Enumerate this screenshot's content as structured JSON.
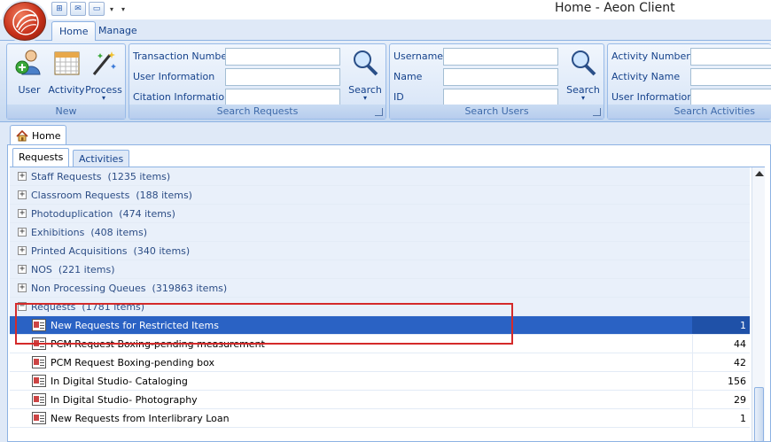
{
  "window": {
    "title": "Home - Aeon Client"
  },
  "ribbon": {
    "tabs": [
      {
        "label": "Home",
        "active": true
      },
      {
        "label": "Manage",
        "active": false
      }
    ],
    "groups": {
      "new": {
        "caption": "New",
        "buttons": [
          {
            "label": "User",
            "icon": "user-add-icon"
          },
          {
            "label": "Activity",
            "icon": "calendar-icon"
          },
          {
            "label": "Process",
            "icon": "wand-icon"
          }
        ]
      },
      "search_requests": {
        "caption": "Search Requests",
        "fields": [
          "Transaction Number",
          "User Information",
          "Citation Information"
        ],
        "values": [
          "",
          "",
          ""
        ],
        "search_label": "Search"
      },
      "search_users": {
        "caption": "Search Users",
        "fields": [
          "Username",
          "Name",
          "ID"
        ],
        "values": [
          "",
          "",
          ""
        ],
        "search_label": "Search"
      },
      "search_activities": {
        "caption": "Search Activities",
        "fields": [
          "Activity Number",
          "Activity Name",
          "User Information"
        ],
        "values": [
          "",
          "",
          ""
        ]
      }
    }
  },
  "document_tab": {
    "label": "Home"
  },
  "subtabs": [
    {
      "label": "Requests",
      "active": true
    },
    {
      "label": "Activities",
      "active": false
    }
  ],
  "groups": [
    {
      "label": "Staff Requests",
      "count": "(1235 items)",
      "expander": "+"
    },
    {
      "label": "Classroom Requests",
      "count": "(188 items)",
      "expander": "+"
    },
    {
      "label": "Photoduplication",
      "count": "(474 items)",
      "expander": "+"
    },
    {
      "label": "Exhibitions",
      "count": "(408 items)",
      "expander": "+"
    },
    {
      "label": "Printed Acquisitions",
      "count": "(340 items)",
      "expander": "+"
    },
    {
      "label": "NOS",
      "count": "(221 items)",
      "expander": "+"
    },
    {
      "label": "Non Processing Queues",
      "count": "(319863 items)",
      "expander": "+"
    },
    {
      "label": "Requests",
      "count": "(1781 items)",
      "expander": "−"
    }
  ],
  "queues": [
    {
      "name": "New Requests for Restricted Items",
      "count": "1",
      "selected": true
    },
    {
      "name": "PCM Request Boxing-pending measurement",
      "count": "44",
      "selected": false
    },
    {
      "name": "PCM Request Boxing-pending box",
      "count": "42",
      "selected": false
    },
    {
      "name": "In Digital Studio- Cataloging",
      "count": "156",
      "selected": false
    },
    {
      "name": "In Digital Studio- Photography",
      "count": "29",
      "selected": false
    },
    {
      "name": "New Requests from Interlibrary Loan",
      "count": "1",
      "selected": false
    }
  ],
  "colors": {
    "accent": "#2a62c4",
    "highlight": "#d42a2a",
    "ribbon": "#dfe9f7"
  }
}
